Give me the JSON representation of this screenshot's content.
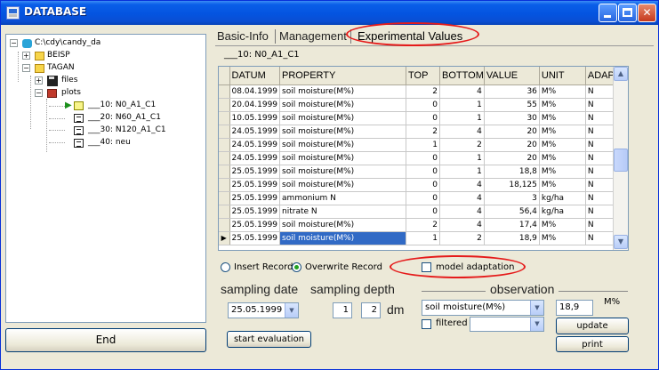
{
  "window": {
    "title": "DATABASE"
  },
  "tree": {
    "root": "C:\\cdy\\candy_da",
    "n1": "BEISP",
    "n2": "TAGAN",
    "n3": "files",
    "n4": "plots",
    "n5": "___10: N0_A1_C1",
    "n6": "___20: N60_A1_C1",
    "n7": "___30: N120_A1_C1",
    "n8": "___40: neu"
  },
  "end_label": "End",
  "tabs": {
    "basic": "Basic-Info",
    "management": "Management",
    "experimental": "Experimental Values"
  },
  "plot_label": "___10: N0_A1_C1",
  "grid": {
    "columns": [
      "DATUM",
      "PROPERTY",
      "TOP",
      "BOTTOM",
      "VALUE",
      "UNIT",
      "ADAPT"
    ],
    "rows": [
      [
        "08.04.1999",
        "soil moisture(M%)",
        "2",
        "4",
        "36",
        "M%",
        "N"
      ],
      [
        "20.04.1999",
        "soil moisture(M%)",
        "0",
        "1",
        "55",
        "M%",
        "N"
      ],
      [
        "10.05.1999",
        "soil moisture(M%)",
        "0",
        "1",
        "30",
        "M%",
        "N"
      ],
      [
        "24.05.1999",
        "soil moisture(M%)",
        "2",
        "4",
        "20",
        "M%",
        "N"
      ],
      [
        "24.05.1999",
        "soil moisture(M%)",
        "1",
        "2",
        "20",
        "M%",
        "N"
      ],
      [
        "24.05.1999",
        "soil moisture(M%)",
        "0",
        "1",
        "20",
        "M%",
        "N"
      ],
      [
        "25.05.1999",
        "soil moisture(M%)",
        "0",
        "1",
        "18,8",
        "M%",
        "N"
      ],
      [
        "25.05.1999",
        "soil moisture(M%)",
        "0",
        "4",
        "18,125",
        "M%",
        "N"
      ],
      [
        "25.05.1999",
        "ammonium N",
        "0",
        "4",
        "3",
        "kg/ha",
        "N"
      ],
      [
        "25.05.1999",
        "nitrate N",
        "0",
        "4",
        "56,4",
        "kg/ha",
        "N"
      ],
      [
        "25.05.1999",
        "soil moisture(M%)",
        "2",
        "4",
        "17,4",
        "M%",
        "N"
      ],
      [
        "25.05.1999",
        "soil moisture(M%)",
        "1",
        "2",
        "18,9",
        "M%",
        "N"
      ]
    ]
  },
  "mode": {
    "insert": "Insert Record",
    "overwrite": "Overwrite Record",
    "selected": "overwrite"
  },
  "model_adaptation": {
    "label": "model adaptation",
    "checked": false
  },
  "sampling": {
    "date_label": "sampling date",
    "date_value": "25.05.1999",
    "depth_label": "sampling depth",
    "depth_from": "1",
    "depth_to": "2",
    "depth_unit": "dm"
  },
  "observation": {
    "label": "observation",
    "property": "soil moisture(M%)",
    "value": "18,9",
    "unit": "M%",
    "filtered_label": "filtered",
    "filtered_value": ""
  },
  "buttons": {
    "update": "update",
    "print": "print",
    "start_evaluation": "start evaluation"
  },
  "colors": {
    "annotation": "#e51b1b",
    "selection": "#316ac5",
    "titlebar": "#0454e0"
  }
}
